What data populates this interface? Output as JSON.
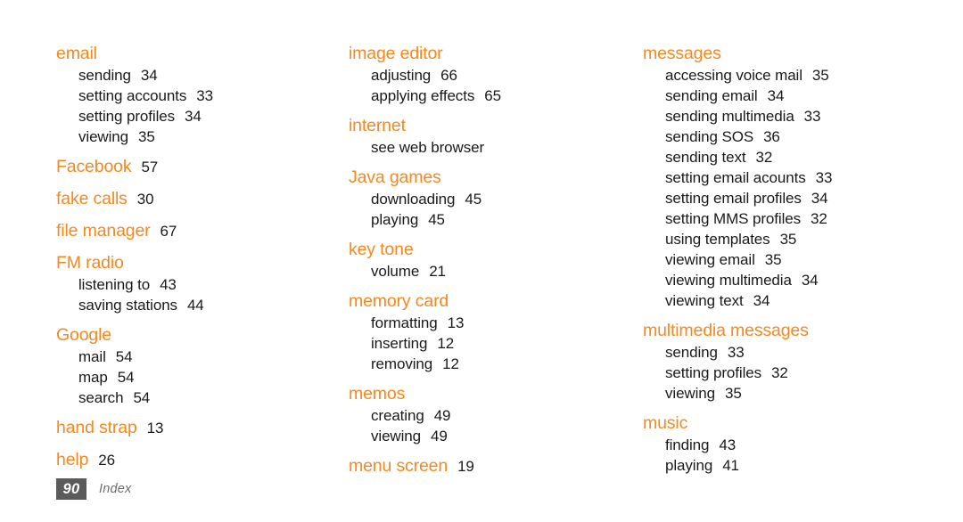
{
  "document": {
    "section_title": "Index",
    "page_number": "90",
    "accent_color": "#f6881f",
    "text_color": "#1a1a1a",
    "footer_box_color": "#5b5b5b",
    "footer_label_color": "#6e6e6e"
  },
  "columns": [
    {
      "entries": [
        {
          "heading": "email",
          "page": "",
          "subs": [
            {
              "label": "sending",
              "page": "34"
            },
            {
              "label": "setting accounts",
              "page": "33"
            },
            {
              "label": "setting profiles",
              "page": "34"
            },
            {
              "label": "viewing",
              "page": "35"
            }
          ]
        },
        {
          "heading": "Facebook",
          "page": "57",
          "subs": []
        },
        {
          "heading": "fake calls",
          "page": "30",
          "subs": []
        },
        {
          "heading": "file manager",
          "page": "67",
          "subs": []
        },
        {
          "heading": "FM radio",
          "page": "",
          "subs": [
            {
              "label": "listening to",
              "page": "43"
            },
            {
              "label": "saving stations",
              "page": "44"
            }
          ]
        },
        {
          "heading": "Google",
          "page": "",
          "subs": [
            {
              "label": "mail",
              "page": "54"
            },
            {
              "label": "map",
              "page": "54"
            },
            {
              "label": "search",
              "page": "54"
            }
          ]
        },
        {
          "heading": "hand strap",
          "page": "13",
          "subs": []
        },
        {
          "heading": "help",
          "page": "26",
          "subs": []
        }
      ]
    },
    {
      "entries": [
        {
          "heading": "image editor",
          "page": "",
          "subs": [
            {
              "label": "adjusting",
              "page": "66"
            },
            {
              "label": "applying effects",
              "page": "65"
            }
          ]
        },
        {
          "heading": "internet",
          "page": "",
          "subs": [
            {
              "label": "see web browser",
              "page": ""
            }
          ]
        },
        {
          "heading": "Java games",
          "page": "",
          "subs": [
            {
              "label": "downloading",
              "page": "45"
            },
            {
              "label": "playing",
              "page": "45"
            }
          ]
        },
        {
          "heading": "key tone",
          "page": "",
          "subs": [
            {
              "label": "volume",
              "page": "21"
            }
          ]
        },
        {
          "heading": "memory card",
          "page": "",
          "subs": [
            {
              "label": "formatting",
              "page": "13"
            },
            {
              "label": "inserting",
              "page": "12"
            },
            {
              "label": "removing",
              "page": "12"
            }
          ]
        },
        {
          "heading": "memos",
          "page": "",
          "subs": [
            {
              "label": "creating",
              "page": "49"
            },
            {
              "label": "viewing",
              "page": "49"
            }
          ]
        },
        {
          "heading": "menu screen",
          "page": "19",
          "subs": []
        }
      ]
    },
    {
      "entries": [
        {
          "heading": "messages",
          "page": "",
          "subs": [
            {
              "label": "accessing voice mail",
              "page": "35"
            },
            {
              "label": "sending email",
              "page": "34"
            },
            {
              "label": "sending multimedia",
              "page": "33"
            },
            {
              "label": "sending SOS",
              "page": "36"
            },
            {
              "label": "sending text",
              "page": "32"
            },
            {
              "label": "setting email acounts",
              "page": "33"
            },
            {
              "label": "setting email profiles",
              "page": "34"
            },
            {
              "label": "setting MMS profiles",
              "page": "32"
            },
            {
              "label": "using templates",
              "page": "35"
            },
            {
              "label": "viewing email",
              "page": "35"
            },
            {
              "label": "viewing multimedia",
              "page": "34"
            },
            {
              "label": "viewing text",
              "page": "34"
            }
          ]
        },
        {
          "heading": "multimedia messages",
          "page": "",
          "subs": [
            {
              "label": "sending",
              "page": "33"
            },
            {
              "label": "setting profiles",
              "page": "32"
            },
            {
              "label": "viewing",
              "page": "35"
            }
          ]
        },
        {
          "heading": "music",
          "page": "",
          "subs": [
            {
              "label": "finding",
              "page": "43"
            },
            {
              "label": "playing",
              "page": "41"
            }
          ]
        }
      ]
    }
  ]
}
